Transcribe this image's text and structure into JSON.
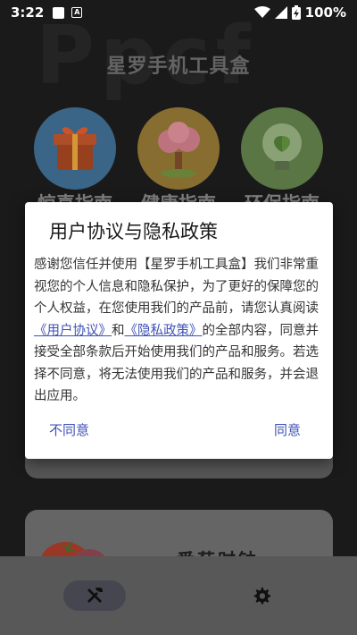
{
  "status_bar": {
    "time": "3:22",
    "battery_text": "100%"
  },
  "app": {
    "title": "星罗手机工具盒",
    "features": [
      {
        "label": "惊喜指南",
        "icon": "gift-box-icon"
      },
      {
        "label": "健康指南",
        "icon": "heart-tree-icon"
      },
      {
        "label": "环保指南",
        "icon": "eco-bulb-icon"
      }
    ],
    "card_title": "番茄时钟"
  },
  "dialog": {
    "title": "用户协议与隐私政策",
    "body_prefix": "感谢您信任并使用【星罗手机工具盒】我们非常重视您的个人信息和隐私保护，为了更好的保障您的个人权益，在您使用我们的产品前，请您认真阅读",
    "link_user_agreement": "《用户协议》",
    "body_and": "和",
    "link_privacy_policy": "《隐私政策》",
    "body_suffix": "的全部内容，同意并接受全部条款后开始使用我们的产品和服务。若选择不同意，将无法使用我们的产品和服务，并会退出应用。",
    "disagree_label": "不同意",
    "agree_label": "同意"
  },
  "colors": {
    "accent": "#3f51b5",
    "dialog_bg": "#ffffff",
    "app_bg": "#1c1c1c"
  }
}
